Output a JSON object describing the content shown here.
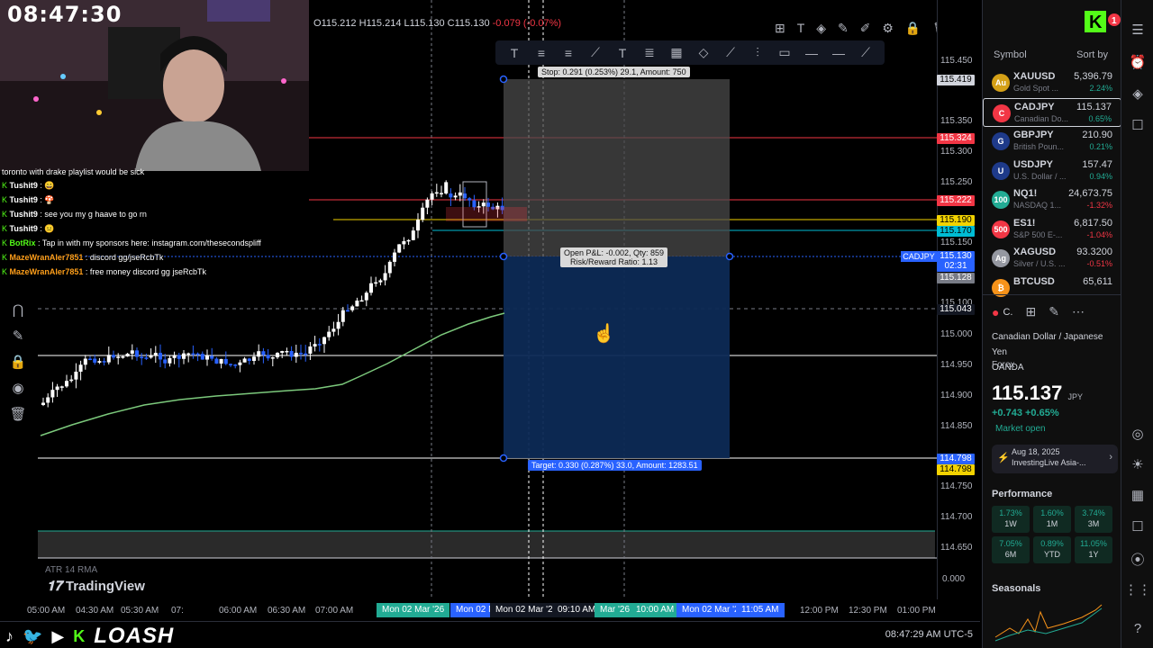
{
  "overlay": {
    "clock": "08:47:30",
    "chat_first": "toronto with drake playlist would be sick",
    "chat": [
      {
        "user": "Tushit9",
        "text": ": 😄",
        "color": "#ffffff"
      },
      {
        "user": "Tushit9",
        "text": ": 🍄",
        "color": "#ffffff"
      },
      {
        "user": "Tushit9",
        "text": ": see you my g haave to go rn",
        "color": "#ffffff"
      },
      {
        "user": "Tushit9",
        "text": ": 😐",
        "color": "#ffffff"
      },
      {
        "user": "BotRix",
        "text": ": Tap in with my sponsors here: instagram.com/thesecondspliff",
        "color": "#53fc18"
      },
      {
        "user": "MazeWranAler7851",
        "text": ": discord gg/jseRcbTk",
        "color": "#ff9f1a"
      },
      {
        "user": "MazeWranAler7851",
        "text": ": free money discord gg jseRcbTk",
        "color": "#ff9f1a"
      }
    ],
    "brand": "LOASH"
  },
  "chart": {
    "ohlc": {
      "o": "115.212",
      "h": "115.214",
      "l": "115.130",
      "c": "115.130",
      "chg": "-0.079 (-0.07%)"
    },
    "symbol_tag": "CADJPY",
    "price_ticks": [
      "115.450",
      "115.350",
      "115.300",
      "115.250",
      "115.150",
      "115.100",
      "115.000",
      "114.950",
      "114.900",
      "114.850",
      "114.750",
      "114.700",
      "114.650"
    ],
    "price_tags": [
      {
        "label": "115.419",
        "bg": "#d1d4dc",
        "fg": "#000000"
      },
      {
        "label": "115.324",
        "bg": "#f23645",
        "fg": "#ffffff"
      },
      {
        "label": "115.222",
        "bg": "#f23645",
        "fg": "#ffffff"
      },
      {
        "label": "115.190",
        "bg": "#f2d200",
        "fg": "#000000"
      },
      {
        "label": "115.170",
        "bg": "#00bcd4",
        "fg": "#000000"
      },
      {
        "label": "115.130",
        "bg": "#2962ff",
        "fg": "#ffffff"
      },
      {
        "label": "02:31",
        "bg": "#2962ff",
        "fg": "#ffffff"
      },
      {
        "label": "115.128",
        "bg": "#787b86",
        "fg": "#ffffff"
      },
      {
        "label": "115.043",
        "bg": "#131722",
        "fg": "#ffffff"
      },
      {
        "label": "114.798",
        "bg": "#2962ff",
        "fg": "#ffffff"
      },
      {
        "label": "114.798",
        "bg": "#f2d200",
        "fg": "#000000"
      }
    ],
    "stop_label": "Stop: 0.291 (0.253%) 29.1, Amount: 750",
    "open_pl": "Open P&L: -0.002, Qty: 859",
    "risk_reward": "Risk/Reward Ratio: 1.13",
    "target_label": "Target: 0.330 (0.287%) 33.0, Amount: 1283.51",
    "atr_label": "ATR 14 RMA",
    "atr_value": "0.000",
    "logo_text": "TradingView",
    "time_ticks": [
      "06:00 AM",
      "06:30 AM",
      "07:00 AM",
      "12:00 PM",
      "12:30 PM",
      "01:00 PM"
    ],
    "time_ticks_partial": [
      "05:00 AM",
      "04:30 AM",
      "05:30 AM",
      "07:"
    ],
    "time_labels": [
      {
        "text": "Mon 02 Mar '26",
        "bg": "#22ab94"
      },
      {
        "text": "Mon 02 M",
        "bg": "#2962ff"
      },
      {
        "text": "Mon 02 Mar '26",
        "bg": "#131722"
      },
      {
        "text": "09:10 AM",
        "bg": "#131722"
      },
      {
        "text": "Mar '26",
        "bg": "#22ab94"
      },
      {
        "text": "10:00 AM",
        "bg": "#22ab94"
      },
      {
        "text": "Mon 02 Mar '26",
        "bg": "#2962ff"
      },
      {
        "text": "11:05 AM",
        "bg": "#2962ff"
      }
    ],
    "status_time": "08:47:29 AM UTC-5"
  },
  "drawing_toolbar": [
    "T",
    "≡",
    "≡",
    "⟋",
    "T",
    "≣",
    "▦",
    "◇",
    "⟋",
    "⫶",
    "▭",
    "—",
    "—",
    "⟋"
  ],
  "watchlist": {
    "header": "Symbol",
    "sort": "Sort by",
    "rows": [
      {
        "sym": "XAUUSD",
        "sub": "Gold Spot ...",
        "price": "5,396.79",
        "chg": "2.24%",
        "dir": "pos",
        "icon_bg": "#d4a017",
        "icon": "Au"
      },
      {
        "sym": "CADJPY",
        "sub": "Canadian Do...",
        "price": "115.137",
        "chg": "0.65%",
        "dir": "pos",
        "icon_bg": "#f23645",
        "icon": "C",
        "selected": true
      },
      {
        "sym": "GBPJPY",
        "sub": "British Poun...",
        "price": "210.90",
        "chg": "0.21%",
        "dir": "pos",
        "icon_bg": "#1e3a8a",
        "icon": "G"
      },
      {
        "sym": "USDJPY",
        "sub": "U.S. Dollar / ...",
        "price": "157.47",
        "chg": "0.94%",
        "dir": "pos",
        "icon_bg": "#1e3a8a",
        "icon": "U"
      },
      {
        "sym": "NQ1!",
        "sub": "NASDAQ 1...",
        "price": "24,673.75",
        "chg": "-1.32%",
        "dir": "neg",
        "icon_bg": "#22ab94",
        "icon": "100"
      },
      {
        "sym": "ES1!",
        "sub": "S&P 500 E-...",
        "price": "6,817.50",
        "chg": "-1.04%",
        "dir": "neg",
        "icon_bg": "#f23645",
        "icon": "500"
      },
      {
        "sym": "XAGUSD",
        "sub": "Silver / U.S. ...",
        "price": "93.3200",
        "chg": "-0.51%",
        "dir": "neg",
        "icon_bg": "#9598a1",
        "icon": "Ag"
      },
      {
        "sym": "BTCUSD",
        "sub": "",
        "price": "65,611",
        "chg": "",
        "dir": "neg",
        "icon_bg": "#f7931a",
        "icon": "₿"
      }
    ]
  },
  "detail": {
    "short": "C.",
    "name": "Canadian Dollar / Japanese Yen",
    "broker": "OANDA",
    "category": "Forex",
    "price": "115.137",
    "currency": "JPY",
    "change": "+0.743  +0.65%",
    "market": "Market open",
    "news_date": "Aug 18, 2025",
    "news_title": "InvestingLive Asia-...",
    "perf_title": "Performance",
    "perf": [
      {
        "v": "1.73%",
        "l": "1W"
      },
      {
        "v": "1.60%",
        "l": "1M"
      },
      {
        "v": "3.74%",
        "l": "3M"
      },
      {
        "v": "7.05%",
        "l": "6M"
      },
      {
        "v": "0.89%",
        "l": "YTD"
      },
      {
        "v": "11.05%",
        "l": "1Y"
      }
    ],
    "seasonals": "Seasonals"
  }
}
